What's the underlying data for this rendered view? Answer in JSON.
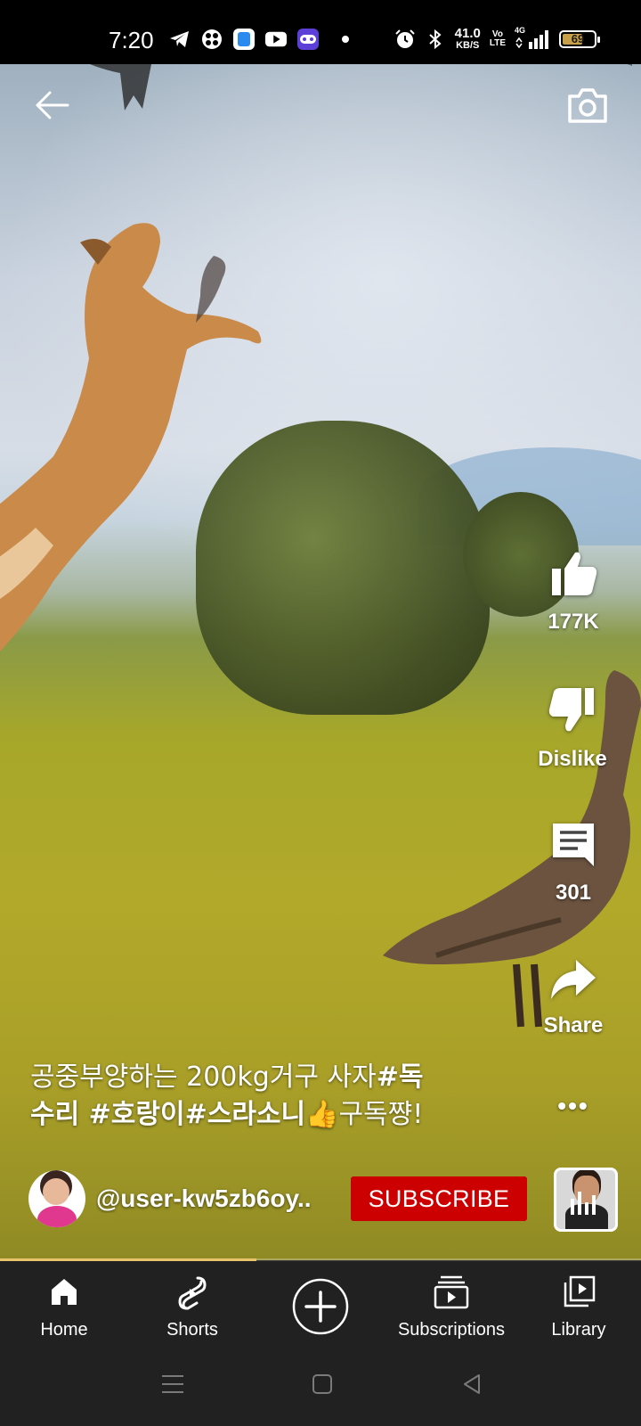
{
  "status_bar": {
    "time": "7:20",
    "network_speed_value": "41.0",
    "network_speed_unit": "KB/S",
    "volte_top": "Vo",
    "volte_bottom": "LTE",
    "signal_label": "4G",
    "battery_percent": "69",
    "battery_level": 0.69,
    "icons": [
      "telegram-icon",
      "app-icon",
      "files-icon",
      "youtube-icon",
      "game-icon",
      "notification-dot",
      "alarm-icon",
      "bluetooth-icon",
      "signal-icon",
      "battery-icon"
    ]
  },
  "video": {
    "caption_plain": "공중부양하는 200kg거구 사자",
    "caption_tags_1": "#독",
    "caption_tags_2": "수리 #호랑이#스라소니",
    "caption_emoji": "👍",
    "caption_end": "구독쨩!",
    "channel_handle": "@user-kw5zb6oy..",
    "subscribe_label": "SUBSCRIBE",
    "progress": 0.4
  },
  "actions": {
    "like_count": "177K",
    "dislike_label": "Dislike",
    "comment_count": "301",
    "share_label": "Share",
    "more_label": "•••"
  },
  "bottom_nav": {
    "home": "Home",
    "shorts": "Shorts",
    "subscriptions": "Subscriptions",
    "library": "Library"
  },
  "colors": {
    "subscribe_bg": "#cc0000",
    "nav_bg": "#212121",
    "progress": "#e8c46a"
  }
}
